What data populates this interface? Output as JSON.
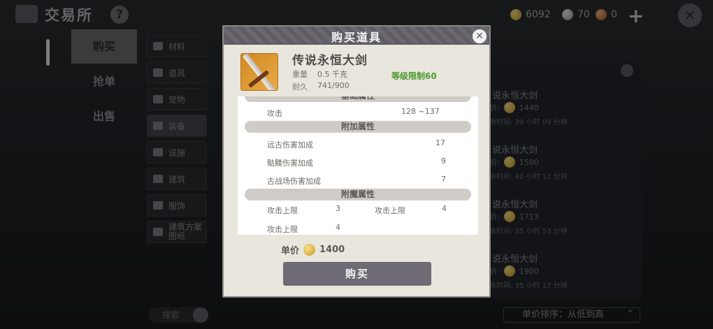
{
  "app": {
    "title": "交易所",
    "help_symbol": "?"
  },
  "currencies": {
    "gold": "6092",
    "silver": "70",
    "bronze": "0",
    "add_symbol": "+"
  },
  "close_symbol": "✕",
  "nav_tabs": [
    {
      "label": "购买",
      "active": true
    },
    {
      "label": "抢单",
      "active": false
    },
    {
      "label": "出售",
      "active": false
    }
  ],
  "categories": [
    {
      "label": "材料",
      "active": false
    },
    {
      "label": "道具",
      "active": false
    },
    {
      "label": "宠物",
      "active": false
    },
    {
      "label": "装备",
      "active": true
    },
    {
      "label": "设施",
      "active": false
    },
    {
      "label": "建筑",
      "active": false
    },
    {
      "label": "服饰",
      "active": false
    },
    {
      "label": "建筑方案图纸",
      "active": false
    }
  ],
  "search": {
    "placeholder": "搜索"
  },
  "listings": [
    {
      "name": "说永恒大剑",
      "price": "1440",
      "time": "余时间: 39 小时 09 分钟"
    },
    {
      "name": "说永恒大剑",
      "price": "1500",
      "time": "余时间: 40 小时 12 分钟"
    },
    {
      "name": "说永恒大剑",
      "price": "1713",
      "time": "余时间: 35 小时 53 分钟"
    },
    {
      "name": "说永恒大剑",
      "price": "1900",
      "time": "余时间: 35 小时 17 分钟"
    }
  ],
  "listing_price_prefix": "价:",
  "sort": {
    "label": "单价排序：从低到高"
  },
  "modal": {
    "title": "购买道具",
    "item": {
      "name": "传说永恒大剑",
      "weight_label": "重量",
      "weight_value": "0.5 千克",
      "durability_label": "耐久",
      "durability_value": "741/900",
      "level_req": "等级限制60"
    },
    "sections": {
      "base": {
        "title": "基础属性",
        "rows": [
          {
            "label": "攻击",
            "value": "128 ~137"
          }
        ]
      },
      "extra": {
        "title": "附加属性",
        "rows": [
          {
            "label": "远古伤害加成",
            "value": "17"
          },
          {
            "label": "骷髅伤害加成",
            "value": "9"
          },
          {
            "label": "古战场伤害加成",
            "value": "7"
          }
        ]
      },
      "enchant": {
        "title": "附魔属性",
        "rows": [
          {
            "label": "攻击上限",
            "value": "3"
          },
          {
            "label": "攻击上限",
            "value": "4"
          },
          {
            "label": "攻击上限",
            "value": "4"
          }
        ]
      }
    },
    "price_label": "单价",
    "price_value": "1400",
    "buy_label": "购买"
  }
}
